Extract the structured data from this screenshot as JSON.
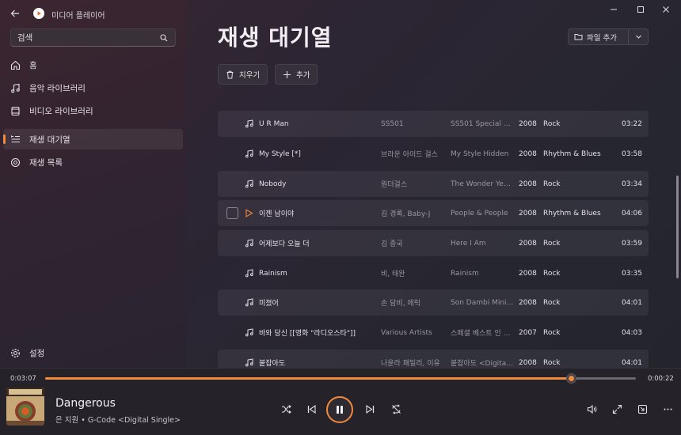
{
  "app": {
    "title": "미디어 플레이어"
  },
  "search": {
    "placeholder": "검색"
  },
  "nav": {
    "home": "홈",
    "music": "음악 라이브러리",
    "video": "비디오 라이브러리",
    "queue": "재생 대기열",
    "playlists": "재생 목록",
    "settings": "설정"
  },
  "page": {
    "title": "재생 대기열",
    "add_folder": "파일 추가",
    "clear": "지우기",
    "add": "추가"
  },
  "songs": [
    {
      "title": "U R Man",
      "artist": "SS501",
      "album": "SS501 Special Album",
      "year": "2008",
      "genre": "Rock",
      "duration": "03:22"
    },
    {
      "title": "My Style [*]",
      "artist": "브라운 아이드 걸스",
      "album": "My Style Hidden",
      "year": "2008",
      "genre": "Rhythm & Blues",
      "duration": "03:58"
    },
    {
      "title": "Nobody",
      "artist": "원더걸스",
      "album": "The Wonder Years",
      "year": "2008",
      "genre": "Rock",
      "duration": "03:34"
    },
    {
      "title": "이젠 남이야",
      "artist": "김 경록, Baby-J",
      "album": "People & People",
      "year": "2008",
      "genre": "Rhythm & Blues",
      "duration": "04:06"
    },
    {
      "title": "어제보다 오늘 더",
      "artist": "김 종국",
      "album": "Here I Am",
      "year": "2008",
      "genre": "Rock",
      "duration": "03:59"
    },
    {
      "title": "Rainism",
      "artist": "비, 태완",
      "album": "Rainism",
      "year": "2008",
      "genre": "Rock",
      "duration": "03:35"
    },
    {
      "title": "미쳤어",
      "artist": "손 담비, 에릭",
      "album": "Son Dambi Mini Album",
      "year": "2008",
      "genre": "Rock",
      "duration": "04:01"
    },
    {
      "title": "바와 당신 [[영화 \"라디오스타\"]]",
      "artist": "Various Artists",
      "album": "스페셜 베스트 인 하모니",
      "year": "2007",
      "genre": "Rock",
      "duration": "04:03"
    },
    {
      "title": "붙잡아도",
      "artist": "나윤라 패밀리, 이유",
      "album": "붙잡아도 <Digital Single>",
      "year": "2008",
      "genre": "Rock",
      "duration": "04:01"
    }
  ],
  "player": {
    "current_time": "0:03:07",
    "remaining_time": "0:00:22",
    "progress": 0.89,
    "title": "Dangerous",
    "subtitle": "은 지원 • G-Code <Digital Single>"
  },
  "colors": {
    "accent": "#f08a3c"
  }
}
